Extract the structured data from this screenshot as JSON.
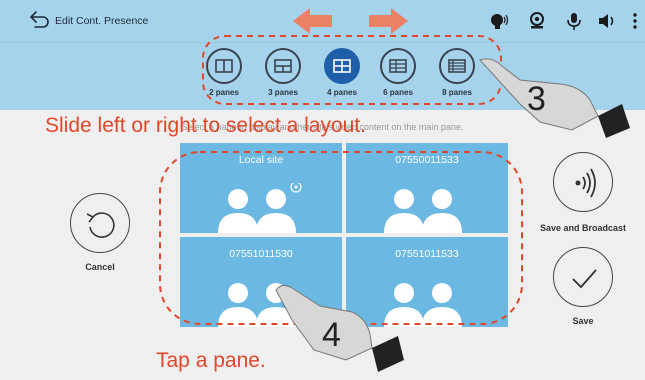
{
  "header": {
    "title": "Edit Cont. Presence",
    "icons": [
      "back-arrow-icon",
      "speaker-voice-icon",
      "camera-icon",
      "microphone-icon",
      "volume-icon",
      "more-vert-icon"
    ]
  },
  "layouts": [
    {
      "label": "2 panes",
      "icon": "layout-2-panes-icon",
      "selected": false
    },
    {
      "label": "3 panes",
      "icon": "layout-3-panes-icon",
      "selected": false
    },
    {
      "label": "4 panes",
      "icon": "layout-4-panes-icon",
      "selected": true
    },
    {
      "label": "6 panes",
      "icon": "layout-6-panes-icon",
      "selected": false
    },
    {
      "label": "8 panes",
      "icon": "layout-8-panes-icon",
      "selected": false
    }
  ],
  "hint": "Select a pane to display another site's video content on the main pane.",
  "panes": [
    {
      "label": "Local site",
      "icon": "two-people-icon"
    },
    {
      "label": "07550011533",
      "icon": "two-people-icon"
    },
    {
      "label": "07551011530",
      "icon": "two-people-icon"
    },
    {
      "label": "07551011533",
      "icon": "two-people-icon"
    }
  ],
  "actions": {
    "cancel_label": "Cancel",
    "save_broadcast_label": "Save and Broadcast",
    "save_label": "Save"
  },
  "annotations": {
    "slide_instruction": "Slide left or right to select a layout.",
    "tap_instruction": "Tap a pane.",
    "step_3": "3",
    "step_4": "4",
    "annotation_color": "#e2472a"
  },
  "colors": {
    "bar": "#a6d3ec",
    "pane": "#6bb9e2",
    "selected": "#1f5ea8",
    "background": "#efefef"
  }
}
